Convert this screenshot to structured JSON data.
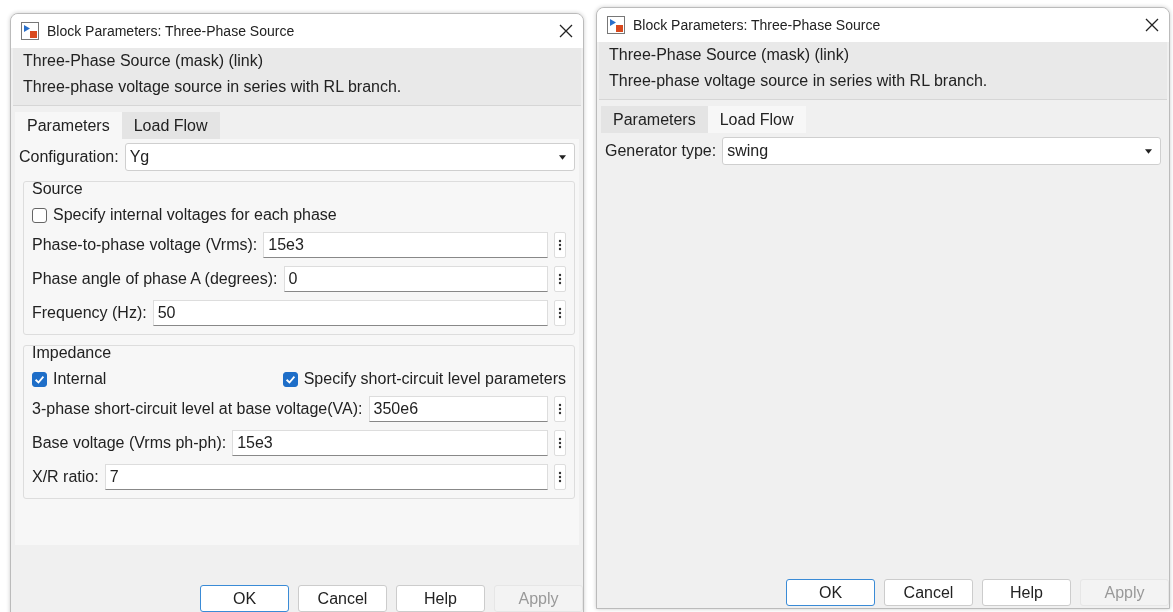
{
  "dialogs": [
    {
      "title": "Block Parameters: Three-Phase Source",
      "mask_title": "Three-Phase Source (mask) (link)",
      "description": "Three-phase voltage source in series with RL branch.",
      "tabs": [
        {
          "label": "Parameters",
          "selected": true
        },
        {
          "label": "Load Flow",
          "selected": false
        }
      ],
      "dropdown": {
        "label": "Configuration:",
        "value": "Yg"
      },
      "groups": [
        {
          "title": "Source",
          "checkboxes": [
            {
              "label": "Specify internal voltages for each phase",
              "checked": false
            }
          ],
          "params": [
            {
              "label": "Phase-to-phase voltage (Vrms):",
              "value": "15e3"
            },
            {
              "label": "Phase angle of phase A (degrees):",
              "value": "0"
            },
            {
              "label": "Frequency (Hz):",
              "value": "50"
            }
          ]
        },
        {
          "title": "Impedance",
          "checkboxes": [
            {
              "label": "Internal",
              "checked": true
            },
            {
              "label": "Specify short-circuit level parameters",
              "checked": true
            }
          ],
          "params": [
            {
              "label": "3-phase short-circuit level at base voltage(VA):",
              "value": "350e6"
            },
            {
              "label": "Base voltage (Vrms ph-ph):",
              "value": "15e3"
            },
            {
              "label": "X/R ratio:",
              "value": "7"
            }
          ]
        }
      ],
      "buttons": [
        {
          "label": "OK",
          "default": true,
          "disabled": false
        },
        {
          "label": "Cancel",
          "default": false,
          "disabled": false
        },
        {
          "label": "Help",
          "default": false,
          "disabled": false
        },
        {
          "label": "Apply",
          "default": false,
          "disabled": true
        }
      ]
    },
    {
      "title": "Block Parameters: Three-Phase Source",
      "mask_title": "Three-Phase Source (mask) (link)",
      "description": "Three-phase voltage source in series with RL branch.",
      "tabs": [
        {
          "label": "Parameters",
          "selected": false
        },
        {
          "label": "Load Flow",
          "selected": true
        }
      ],
      "dropdown": {
        "label": "Generator type:",
        "value": "swing"
      },
      "buttons": [
        {
          "label": "OK",
          "default": true,
          "disabled": false
        },
        {
          "label": "Cancel",
          "default": false,
          "disabled": false
        },
        {
          "label": "Help",
          "default": false,
          "disabled": false
        },
        {
          "label": "Apply",
          "default": false,
          "disabled": true
        }
      ]
    }
  ]
}
